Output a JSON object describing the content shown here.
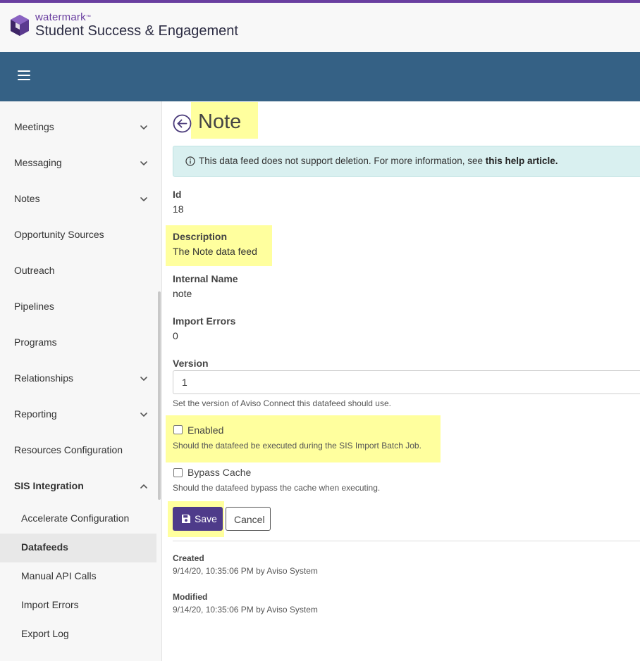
{
  "brand": {
    "small": "watermark",
    "tm": "™",
    "big": "Student Success & Engagement"
  },
  "nav": {
    "menu_icon": "hamburger-icon"
  },
  "sidebar": {
    "items": [
      {
        "label": "Meetings",
        "expandable": true
      },
      {
        "label": "Messaging",
        "expandable": true
      },
      {
        "label": "Notes",
        "expandable": true
      },
      {
        "label": "Opportunity Sources",
        "expandable": false
      },
      {
        "label": "Outreach",
        "expandable": false
      },
      {
        "label": "Pipelines",
        "expandable": false
      },
      {
        "label": "Programs",
        "expandable": false
      },
      {
        "label": "Relationships",
        "expandable": true
      },
      {
        "label": "Reporting",
        "expandable": true
      },
      {
        "label": "Resources Configuration",
        "expandable": false
      },
      {
        "label": "SIS Integration",
        "expandable": true,
        "expanded": true
      }
    ],
    "subitems": [
      {
        "label": "Accelerate Configuration"
      },
      {
        "label": "Datafeeds",
        "active": true
      },
      {
        "label": "Manual API Calls"
      },
      {
        "label": "Import Errors"
      },
      {
        "label": "Export Log"
      }
    ]
  },
  "page": {
    "title": "Note",
    "back_icon": "arrow-left-circle-icon"
  },
  "alert": {
    "text": "This data feed does not support deletion. For more information, see ",
    "link": "this help article."
  },
  "fields": {
    "id_label": "Id",
    "id_value": "18",
    "description_label": "Description",
    "description_value": "The Note data feed",
    "internal_name_label": "Internal Name",
    "internal_name_value": "note",
    "import_errors_label": "Import Errors",
    "import_errors_value": "0",
    "version_label": "Version",
    "version_value": "1",
    "version_help": "Set the version of Aviso Connect this datafeed should use."
  },
  "checkboxes": {
    "enabled_label": "Enabled",
    "enabled_checked": false,
    "enabled_help": "Should the datafeed be executed during the SIS Import Batch Job.",
    "bypass_label": "Bypass Cache",
    "bypass_checked": false,
    "bypass_help": "Should the datafeed bypass the cache when executing."
  },
  "buttons": {
    "save_label": "Save",
    "cancel_label": "Cancel"
  },
  "meta": {
    "created_label": "Created",
    "created_value": "9/14/20, 10:35:06 PM by Aviso System",
    "modified_label": "Modified",
    "modified_value": "9/14/20, 10:35:06 PM by Aviso System"
  },
  "colors": {
    "accent_purple": "#6a3fa0",
    "nav_blue": "#356185",
    "save_button": "#4e3b8a",
    "alert_bg": "#d9f0f0",
    "highlight": "#ffff9e"
  }
}
